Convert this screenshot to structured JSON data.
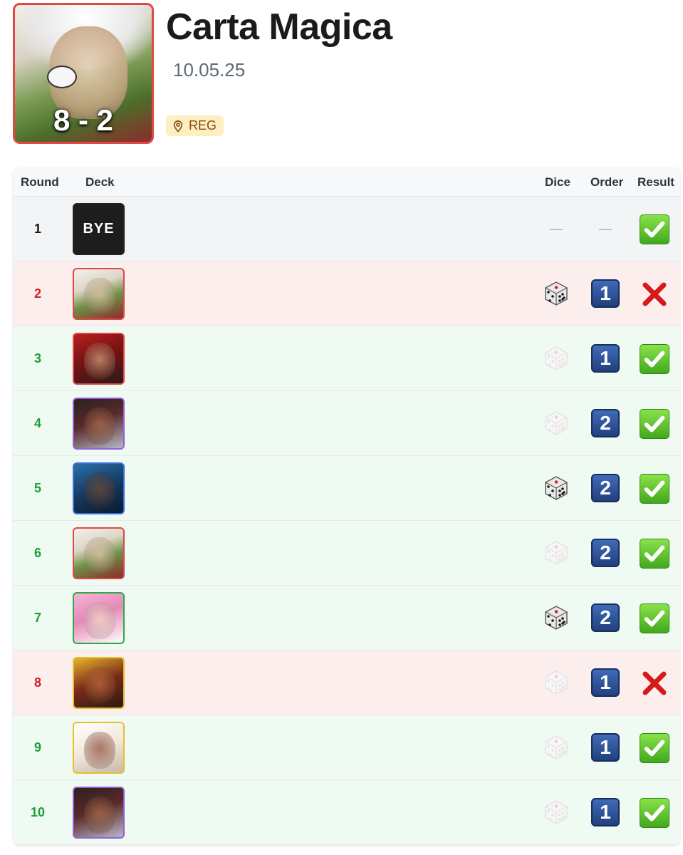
{
  "header": {
    "title": "Carta Magica",
    "date": "10.05.25",
    "score": "8 - 2",
    "tag": "REG",
    "tag_icon": "map-pin-icon"
  },
  "table": {
    "columns": [
      "Round",
      "Deck",
      "Dice",
      "Order",
      "Result"
    ],
    "rows": [
      {
        "round": "1",
        "deck": "BYE",
        "dice": "—",
        "order": "—",
        "result": "win"
      },
      {
        "round": "2",
        "deck": "red-leader-1",
        "dice": "dark",
        "order": "1",
        "result": "loss"
      },
      {
        "round": "3",
        "deck": "red-leader-2",
        "dice": "light",
        "order": "1",
        "result": "win"
      },
      {
        "round": "4",
        "deck": "purple-leader-1",
        "dice": "light",
        "order": "2",
        "result": "win"
      },
      {
        "round": "5",
        "deck": "blue-leader-1",
        "dice": "dark",
        "order": "2",
        "result": "win"
      },
      {
        "round": "6",
        "deck": "red-leader-1",
        "dice": "light",
        "order": "2",
        "result": "win"
      },
      {
        "round": "7",
        "deck": "green-leader-1",
        "dice": "dark",
        "order": "2",
        "result": "win"
      },
      {
        "round": "8",
        "deck": "yellow-leader-1",
        "dice": "light",
        "order": "1",
        "result": "loss"
      },
      {
        "round": "9",
        "deck": "yellow-leader-2",
        "dice": "light",
        "order": "1",
        "result": "win"
      },
      {
        "round": "10",
        "deck": "purple-leader-1",
        "dice": "light",
        "order": "1",
        "result": "win"
      }
    ]
  },
  "colors": {
    "win": "#1f9d3a",
    "loss": "#d32222",
    "win_bg": "#effaf2",
    "loss_bg": "#fdeeee",
    "order_blue": "#2b4c8f"
  }
}
